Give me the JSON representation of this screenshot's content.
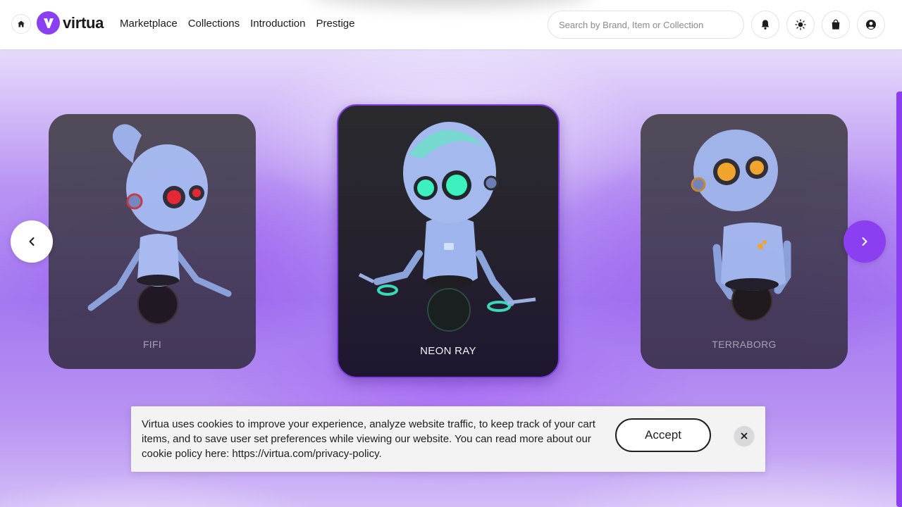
{
  "header": {
    "logo_text": "virtua",
    "nav": [
      {
        "label": "Marketplace"
      },
      {
        "label": "Collections"
      },
      {
        "label": "Introduction"
      },
      {
        "label": "Prestige"
      }
    ],
    "search_placeholder": "Search by Brand, Item or Collection",
    "icons": [
      "home-icon",
      "bell-icon",
      "sun-icon",
      "shopping-bag-icon",
      "user-icon"
    ]
  },
  "carousel": {
    "cards": [
      {
        "name": "FIFI",
        "eye_color": "#e8252a",
        "state": "side"
      },
      {
        "name": "NEON RAY",
        "eye_color": "#3cf0c0",
        "state": "active"
      },
      {
        "name": "TERRABORG",
        "eye_color": "#f5a623",
        "state": "side"
      }
    ],
    "prev_icon": "chevron-left-icon",
    "next_icon": "chevron-right-icon"
  },
  "cookie_banner": {
    "text": "Virtua uses cookies to improve your experience, analyze website traffic, to keep track of your cart items, and to save user set preferences while viewing our website. You can read more about our cookie policy here: https://virtua.com/privacy-policy.",
    "accept_label": "Accept",
    "close_icon": "close-icon"
  },
  "colors": {
    "accent": "#8b3ff0",
    "card_active_border": "#7d3ee6"
  }
}
